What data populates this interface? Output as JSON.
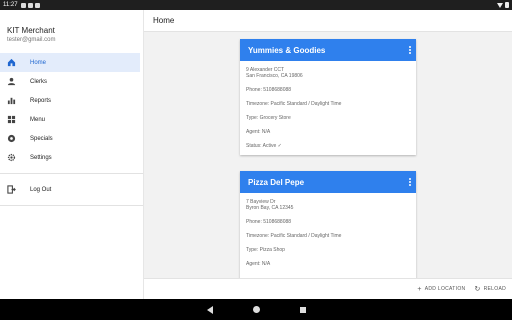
{
  "status_bar": {
    "time": "11:27"
  },
  "sidebar": {
    "merchant_name": "KIT Merchant",
    "email": "tester@gmail.com",
    "items": [
      {
        "label": "Home",
        "icon": "home-icon"
      },
      {
        "label": "Clerks",
        "icon": "person-icon"
      },
      {
        "label": "Reports",
        "icon": "bar-chart-icon"
      },
      {
        "label": "Menu",
        "icon": "grid-icon"
      },
      {
        "label": "Specials",
        "icon": "badge-icon"
      },
      {
        "label": "Settings",
        "icon": "gear-icon"
      }
    ],
    "logout": {
      "label": "Log Out",
      "icon": "logout-icon"
    }
  },
  "header": {
    "title": "Home"
  },
  "locations": [
    {
      "name": "Yummies & Goodies",
      "address_line1": "9 Alexander CCT",
      "address_line2": "San Francisco, CA 19806",
      "phone": "Phone: 5108688088",
      "timezone": "Timezone: Pacific Standard / Daylight Time",
      "type": "Type: Grocery Store",
      "agent": "Agent: N/A",
      "status": "Status: Active ✓"
    },
    {
      "name": "Pizza Del Pepe",
      "address_line1": "7 Bayview Dr",
      "address_line2": "Byron Bay, CA 12345",
      "phone": "Phone: 5108688088",
      "timezone": "Timezone: Pacific Standard / Daylight Time",
      "type": "Type: Pizza Shop",
      "agent": "Agent: N/A"
    }
  ],
  "footer": {
    "add_location": "ADD LOCATION",
    "reload": "RELOAD"
  },
  "colors": {
    "accent": "#2f80ed",
    "active_nav_bg": "#e3ecfb",
    "active_nav_text": "#1e66d0"
  }
}
